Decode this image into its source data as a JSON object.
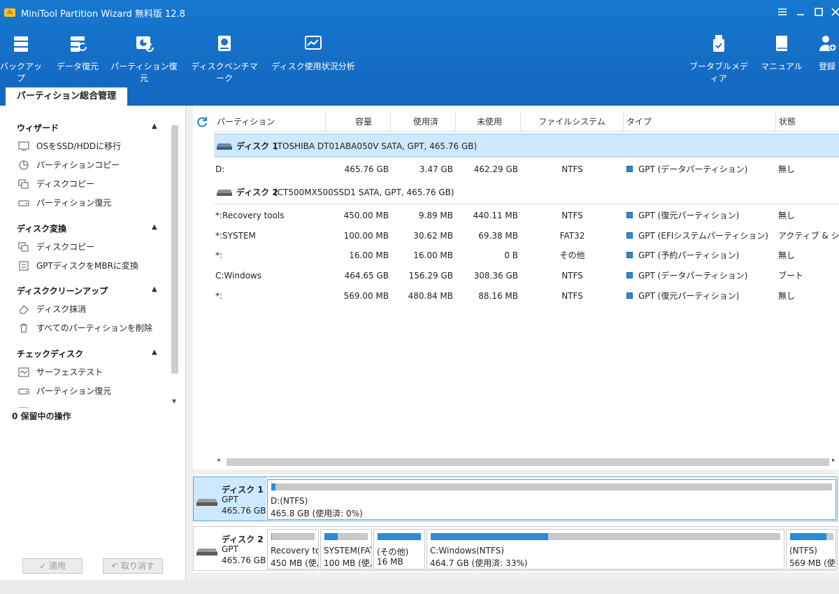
{
  "app": {
    "title": "MiniTool Partition Wizard 無料版 12.8"
  },
  "toolbar": {
    "left": [
      {
        "label": "バックアップ",
        "icon": "backup-icon"
      },
      {
        "label": "データ復元",
        "icon": "data-recovery-icon"
      },
      {
        "label": "パーティション復元",
        "icon": "partition-recovery-icon"
      },
      {
        "label": "ディスクベンチマーク",
        "icon": "disk-benchmark-icon"
      },
      {
        "label": "ディスク使用状況分析",
        "icon": "space-analyzer-icon"
      }
    ],
    "right": [
      {
        "label": "ブータブルメディア",
        "icon": "bootable-media-icon"
      },
      {
        "label": "マニュアル",
        "icon": "manual-icon"
      },
      {
        "label": "登録",
        "icon": "register-icon"
      }
    ]
  },
  "tab": {
    "label": "パーティション総合管理"
  },
  "sidebar": {
    "sections": [
      {
        "title": "ウィザード",
        "items": [
          "OSをSSD/HDDに移行",
          "パーティションコピー",
          "ディスクコピー",
          "パーティション復元"
        ]
      },
      {
        "title": "ディスク変換",
        "items": [
          "ディスクコピー",
          "GPTディスクをMBRに変換"
        ]
      },
      {
        "title": "ディスククリーンアップ",
        "items": [
          "ディスク抹消",
          "すべてのパーティションを削除"
        ]
      },
      {
        "title": "チェックディスク",
        "items": [
          "サーフェステスト",
          "パーティション復元"
        ]
      }
    ],
    "pending": "0 保留中の操作",
    "apply_label": "✓ 適用",
    "undo_label": "↶ 取り消す"
  },
  "table": {
    "headers": [
      "パーティション",
      "容量",
      "使用済",
      "未使用",
      "ファイルシステム",
      "タイプ",
      "状態"
    ],
    "disks": [
      {
        "name": "ディスク 1",
        "info": "(TOSHIBA DT01ABA050V SATA, GPT, 465.76 GB)",
        "partitions": [
          {
            "name": "D:",
            "capacity": "465.76 GB",
            "used": "3.47 GB",
            "unused": "462.29 GB",
            "fs": "NTFS",
            "type": "GPT (データパーティション)",
            "status": "無し"
          }
        ]
      },
      {
        "name": "ディスク 2",
        "info": "(CT500MX500SSD1 SATA, GPT, 465.76 GB)",
        "partitions": [
          {
            "name": "*:Recovery tools",
            "capacity": "450.00 MB",
            "used": "9.89 MB",
            "unused": "440.11 MB",
            "fs": "NTFS",
            "type": "GPT (復元パーティション)",
            "status": "無し"
          },
          {
            "name": "*:SYSTEM",
            "capacity": "100.00 MB",
            "used": "30.62 MB",
            "unused": "69.38 MB",
            "fs": "FAT32",
            "type": "GPT (EFIシステムパーティション)",
            "status": "アクティブ & シ..."
          },
          {
            "name": "*:",
            "capacity": "16.00 MB",
            "used": "16.00 MB",
            "unused": "0 B",
            "fs": "その他",
            "type": "GPT (予約パーティション)",
            "status": "無し"
          },
          {
            "name": "C:Windows",
            "capacity": "464.65 GB",
            "used": "156.29 GB",
            "unused": "308.36 GB",
            "fs": "NTFS",
            "type": "GPT (データパーティション)",
            "status": "ブート"
          },
          {
            "name": "*:",
            "capacity": "569.00 MB",
            "used": "480.84 MB",
            "unused": "88.16 MB",
            "fs": "NTFS",
            "type": "GPT (復元パーティション)",
            "status": "無し"
          }
        ]
      }
    ]
  },
  "diskmap": {
    "disks": [
      {
        "name": "ディスク 1",
        "type": "GPT",
        "size": "465.76 GB",
        "partitions": [
          {
            "label": "D:(NTFS)",
            "detail": "465.8 GB (使用済: 0%)",
            "fill": 0.008
          }
        ]
      },
      {
        "name": "ディスク 2",
        "type": "GPT",
        "size": "465.76 GB",
        "partitions": [
          {
            "label": "Recovery to",
            "detail": "450 MB (使月",
            "fill": 0.02
          },
          {
            "label": "SYSTEM(FAT",
            "detail": "100 MB (使月",
            "fill": 0.31
          },
          {
            "label": "(その他)",
            "detail": "16 MB",
            "fill": 1.0
          },
          {
            "label": "C:Windows(NTFS)",
            "detail": "464.7 GB (使用済: 33%)",
            "fill": 0.336
          },
          {
            "label": "(NTFS)",
            "detail": "569 MB (使月",
            "fill": 0.845
          }
        ]
      }
    ]
  },
  "colors": {
    "accent": "#1677cf",
    "selection": "#cde8ff",
    "bar_fill": "#2c8ad7",
    "bar_bg": "#c8c8c8"
  }
}
